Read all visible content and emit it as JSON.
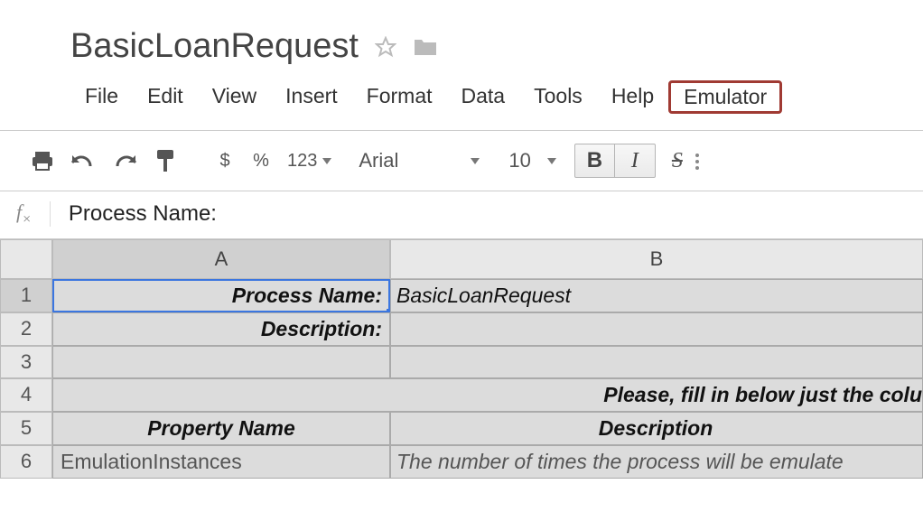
{
  "title": "BasicLoanRequest",
  "menu": {
    "file": "File",
    "edit": "Edit",
    "view": "View",
    "insert": "Insert",
    "format": "Format",
    "data": "Data",
    "tools": "Tools",
    "help": "Help",
    "emulator": "Emulator"
  },
  "toolbar": {
    "currency": "$",
    "percent": "%",
    "decimals": "123",
    "font": "Arial",
    "size": "10",
    "bold": "B",
    "italic": "I",
    "strike": "S"
  },
  "formula": {
    "fx": "f",
    "fx_sub": "×",
    "content": "Process Name:"
  },
  "columns": {
    "a": "A",
    "b": "B"
  },
  "rows": {
    "r1": "1",
    "r2": "2",
    "r3": "3",
    "r4": "4",
    "r5": "5",
    "r6": "6"
  },
  "cells": {
    "a1": "Process Name:",
    "b1": "BasicLoanRequest",
    "a2": "Description:",
    "b2": "",
    "a3": "",
    "b3": "",
    "row4": "Please, fill in below just the colu",
    "a5": "Property Name",
    "b5": "Description",
    "a6": "EmulationInstances",
    "b6": "The number of times the process will be emulate"
  }
}
